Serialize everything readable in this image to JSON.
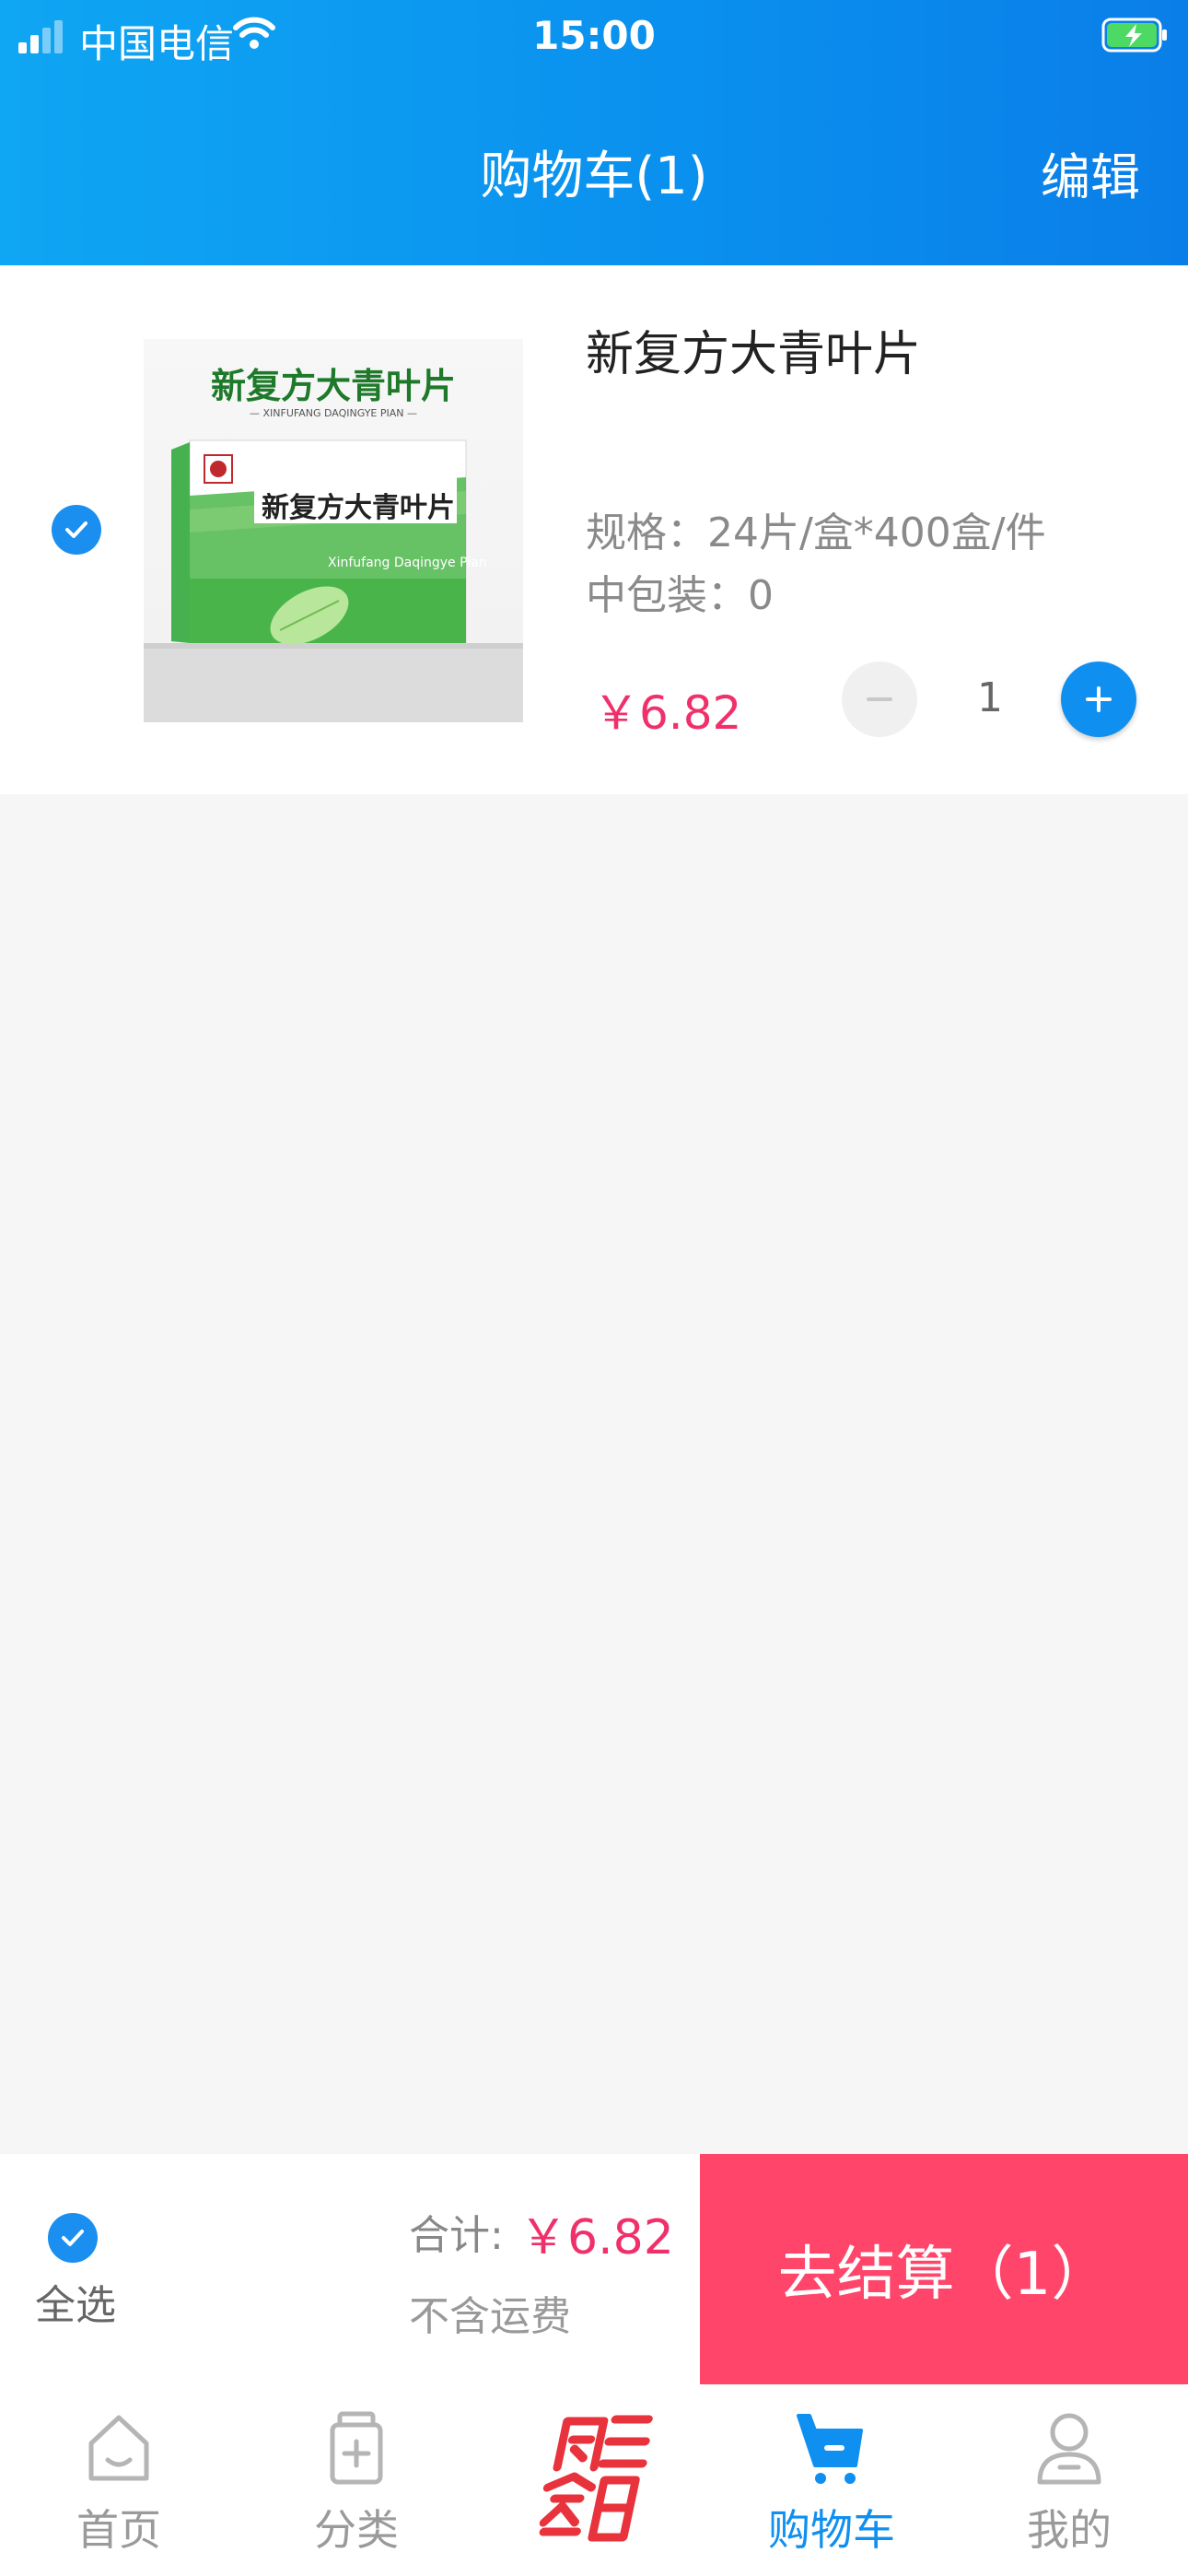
{
  "status_bar": {
    "carrier": "中国电信",
    "time": "15:00"
  },
  "header": {
    "title": "购物车(1)",
    "edit_label": "编辑"
  },
  "cart_item": {
    "name": "新复方大青叶片",
    "spec": "规格：24片/盒*400盒/件",
    "inner_pack": "中包装：0",
    "price": "￥6.82",
    "quantity": "1",
    "checked": true,
    "image": {
      "box_title": "新复方大青叶片",
      "box_pinyin": "— XINFUFANG DAQINGYE PIAN —",
      "box_name": "新复方大青叶片",
      "box_english": "Xinfufang Daqingye Pian"
    }
  },
  "checkout": {
    "select_all_label": "全选",
    "total_label": "合计:",
    "total_value": "￥6.82",
    "shipping_note": "不含运费",
    "button_label": "去结算（1）"
  },
  "tabbar": {
    "tabs": [
      {
        "label": "首页",
        "icon": "home-icon"
      },
      {
        "label": "分类",
        "icon": "category-icon"
      },
      {
        "label": "",
        "icon": "wednesday-member-day-logo"
      },
      {
        "label": "购物车",
        "icon": "cart-icon",
        "active": true
      },
      {
        "label": "我的",
        "icon": "profile-icon"
      }
    ]
  },
  "colors": {
    "header_blue": "#0a8fee",
    "accent_blue": "#0f8ff0",
    "price_red": "#f0306a",
    "checkout_pink": "#ff4569"
  }
}
